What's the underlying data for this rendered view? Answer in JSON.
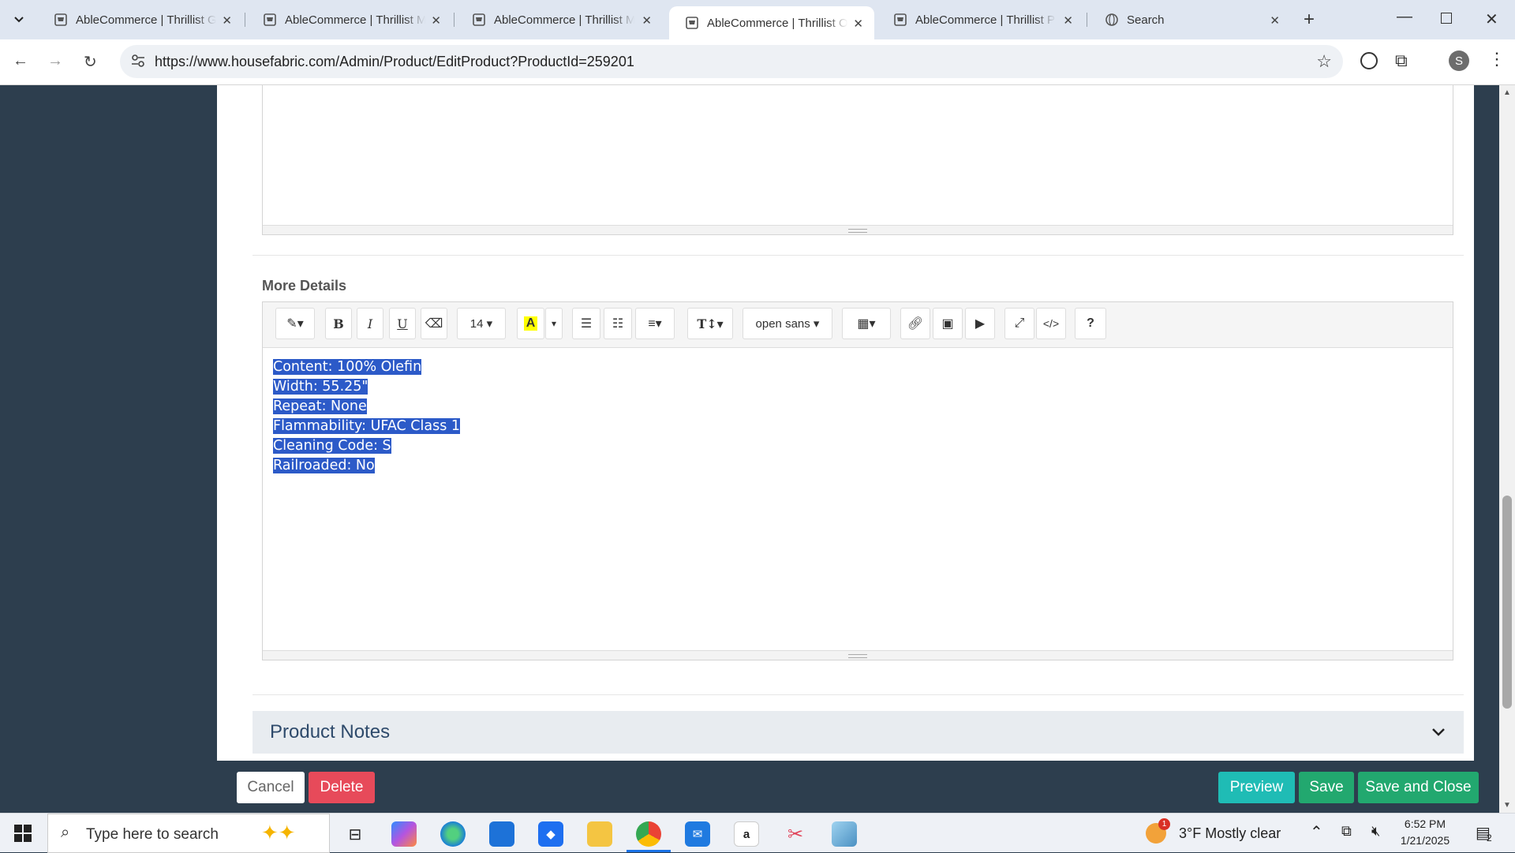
{
  "browser": {
    "tabs": [
      {
        "label": "AbleCommerce | Thrillist G"
      },
      {
        "label": "AbleCommerce | Thrillist M"
      },
      {
        "label": "AbleCommerce | Thrillist M"
      },
      {
        "label": "AbleCommerce | Thrillist O"
      },
      {
        "label": "AbleCommerce | Thrillist P"
      },
      {
        "label": "Search"
      }
    ],
    "url": "https://www.housefabric.com/Admin/Product/EditProduct?ProductId=259201",
    "profile_initial": "S"
  },
  "editor": {
    "section_label": "More Details",
    "font_size": "14",
    "font_name": "open sans",
    "content_lines": [
      "Content: 100% Olefin",
      "Width: 55.25\"",
      "Repeat: None",
      "Flammability: UFAC Class 1",
      "Cleaning Code: S",
      "Railroaded: No"
    ]
  },
  "notes": {
    "title": "Product Notes"
  },
  "footer": {
    "cancel": "Cancel",
    "delete": "Delete",
    "preview": "Preview",
    "save": "Save",
    "save_close": "Save and Close"
  },
  "taskbar": {
    "search_placeholder": "Type here to search",
    "weather": "3°F  Mostly clear",
    "weather_badge": "1",
    "time": "6:52 PM",
    "date": "1/21/2025",
    "notif_count": "2"
  },
  "colors": {
    "sidebar": "#2d3e4e",
    "preview": "#1fbcb5",
    "save": "#22a86f",
    "delete": "#e74a5a",
    "selection": "#2c5ac8"
  }
}
